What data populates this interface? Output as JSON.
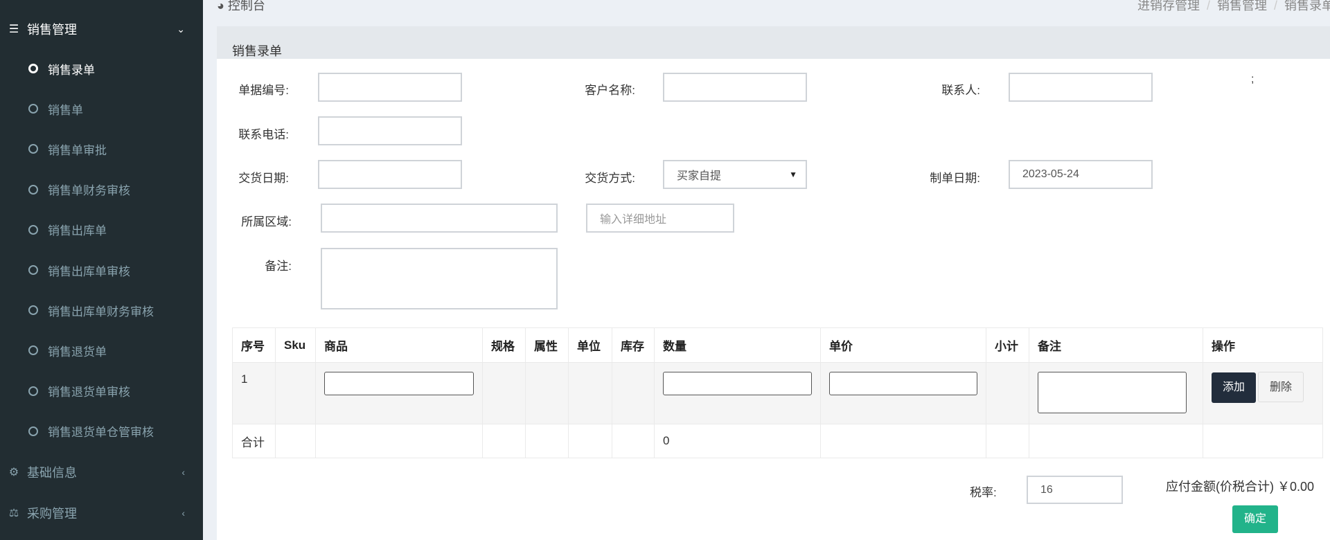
{
  "sidebar": {
    "sales_group": "销售管理",
    "items": [
      "销售录单",
      "销售单",
      "销售单审批",
      "销售单财务审核",
      "销售出库单",
      "销售出库单审核",
      "销售出库单财务审核",
      "销售退货单",
      "销售退货单审核",
      "销售退货单仓管审核"
    ],
    "basic_info": "基础信息",
    "purchase": "采购管理"
  },
  "header": {
    "console": "控制台",
    "breadcrumb": [
      "进销存管理",
      "销售管理",
      "销售录单"
    ]
  },
  "panel": {
    "title": "销售录单"
  },
  "form": {
    "doc_no_label": "单据编号:",
    "doc_no": "",
    "customer_label": "客户名称:",
    "customer": "",
    "contact_label": "联系人:",
    "contact": "",
    "semicolon": ";",
    "phone_label": "联系电话:",
    "phone": "",
    "delivery_date_label": "交货日期:",
    "delivery_date": "",
    "delivery_method_label": "交货方式:",
    "delivery_method": "买家自提",
    "created_date_label": "制单日期:",
    "created_date": "2023-05-24",
    "region_label": "所属区域:",
    "region": "",
    "address_placeholder": "输入详细地址",
    "remark_label": "备注:"
  },
  "table": {
    "headers": [
      "序号",
      "Sku",
      "商品",
      "规格",
      "属性",
      "单位",
      "库存",
      "数量",
      "单价",
      "小计",
      "备注",
      "操作"
    ],
    "row": {
      "index": "1"
    },
    "add": "添加",
    "delete": "删除",
    "total_label": "合计",
    "total_qty": "0"
  },
  "footer": {
    "tax_label": "税率:",
    "tax": "16",
    "payable_label": "应付金额(价税合计)",
    "payable": "￥0.00",
    "confirm": "确定"
  }
}
